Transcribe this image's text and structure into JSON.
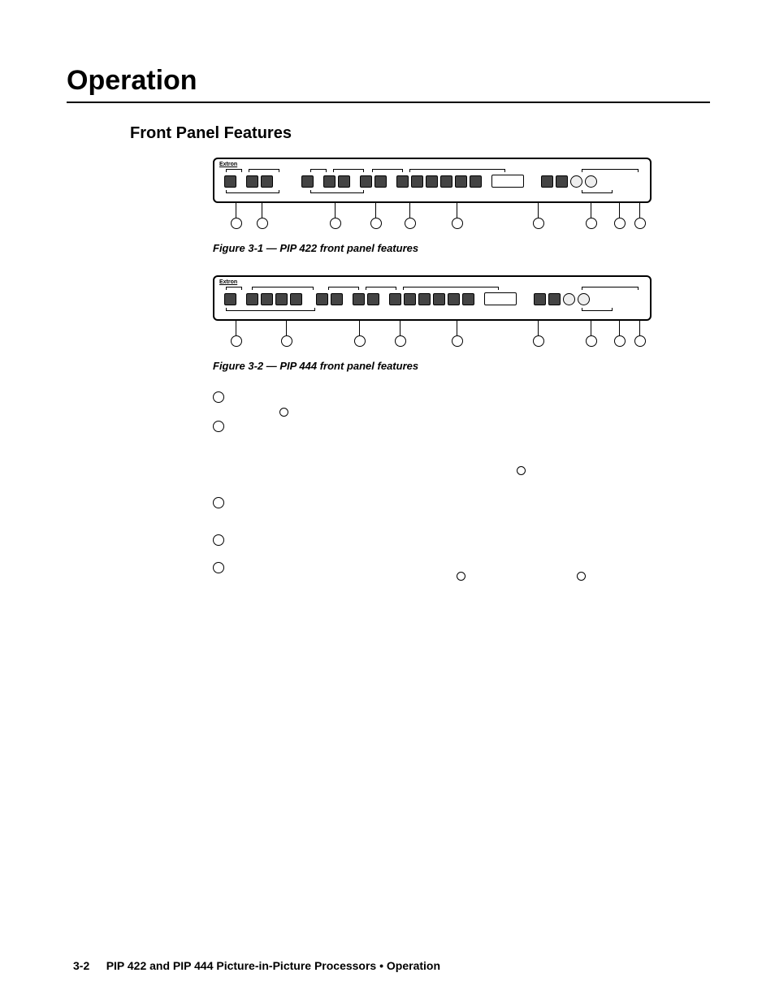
{
  "chapter": "Operation",
  "section": "Front Panel Features",
  "brand": "Extron",
  "fig1_caption": "Figure 3-1 — PIP 422 front panel features",
  "fig2_caption": "Figure 3-2 — PIP 444 front panel features",
  "footer": {
    "pagenum": "3-2",
    "text": "PIP 422 and PIP 444 Picture-in-Picture Processors • Operation"
  }
}
